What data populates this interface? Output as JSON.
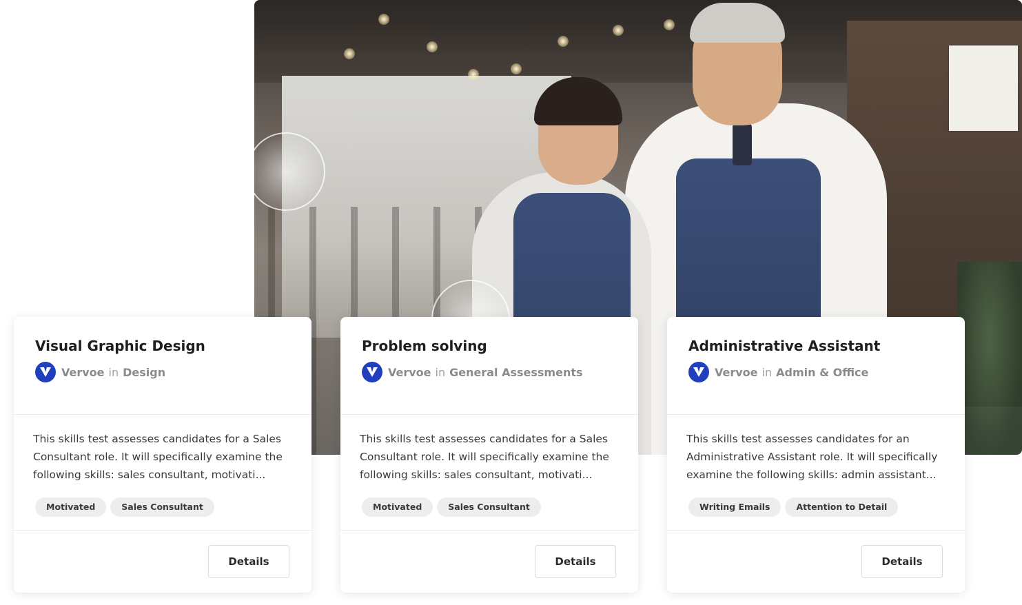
{
  "brand": {
    "name": "Vervoe",
    "connector": "in",
    "logo_icon": "vervoe-v-logo-icon",
    "logo_color": "#1f3fbe"
  },
  "hero": {
    "image_subject": "two smiling cafe owners wearing denim aprons"
  },
  "cards": [
    {
      "title": "Visual Graphic Design",
      "category": "Design",
      "description": "This skills test assesses candidates for a Sales Consultant role. It will specifically examine the following skills: sales consultant, motivati...",
      "tags": [
        "Motivated",
        "Sales Consultant"
      ],
      "button": "Details"
    },
    {
      "title": "Problem solving",
      "category": "General Assessments",
      "description": "This skills test assesses candidates for a Sales Consultant role. It will specifically examine the following skills: sales consultant, motivati...",
      "tags": [
        "Motivated",
        "Sales Consultant"
      ],
      "button": "Details"
    },
    {
      "title": "Administrative Assistant",
      "category": "Admin & Office",
      "description": "This skills test assesses candidates for an Administrative Assistant role. It will specifically examine the following skills: admin assistant...",
      "tags": [
        "Writing Emails",
        "Attention to Detail"
      ],
      "button": "Details"
    }
  ]
}
